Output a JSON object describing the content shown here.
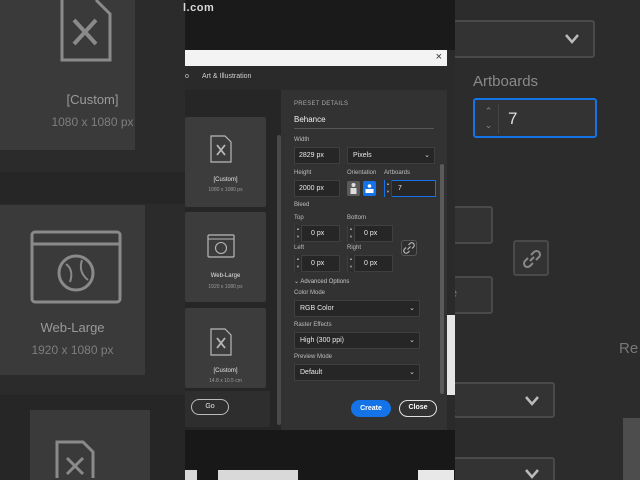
{
  "top": {
    "url_fragment": "l.com"
  },
  "left_zoom": {
    "card1_title": "[Custom]",
    "card1_size": "1080 x 1080 px",
    "card2_title": "Web-Large",
    "card2_size": "1920 x 1080 px"
  },
  "right_zoom": {
    "artboards_label": "Artboards",
    "artboards_value": "7",
    "partial_text_1": "Re",
    "partial_text_2": "le",
    "partial_text_3": "ev"
  },
  "dialog": {
    "close": "×",
    "tabs": [
      "o",
      "Art & Illustration"
    ],
    "templates": [
      {
        "title": "[Custom]",
        "size": "1080 x 1080 px",
        "icon": "custom-document-icon"
      },
      {
        "title": "Web-Large",
        "size": "1920 x 1080 px",
        "icon": "web-globe-icon"
      },
      {
        "title": "[Custom]",
        "size": "14.8 x 10.5 cm",
        "icon": "custom-document-icon"
      }
    ],
    "go_label": "Go",
    "details": {
      "section_label": "PRESET DETAILS",
      "preset_name": "Behance",
      "width_label": "Width",
      "width_value": "2829 px",
      "units_value": "Pixels",
      "height_label": "Height",
      "height_value": "2000 px",
      "orientation_label": "Orientation",
      "artboards_label": "Artboards",
      "artboards_value": "7",
      "bleed_label": "Bleed",
      "top_label": "Top",
      "top_value": "0 px",
      "bottom_label": "Bottom",
      "bottom_value": "0 px",
      "left_label": "Left",
      "left_value": "0 px",
      "right_label": "Right",
      "right_value": "0 px",
      "advanced_label": "Advanced Options",
      "color_mode_label": "Color Mode",
      "color_mode_value": "RGB Color",
      "raster_label": "Raster Effects",
      "raster_value": "High (300 ppi)",
      "preview_label": "Preview Mode",
      "preview_value": "Default"
    },
    "create_label": "Create",
    "close_label": "Close"
  },
  "colors": {
    "accent": "#1473e6",
    "panel": "#323232",
    "field": "#262626"
  }
}
